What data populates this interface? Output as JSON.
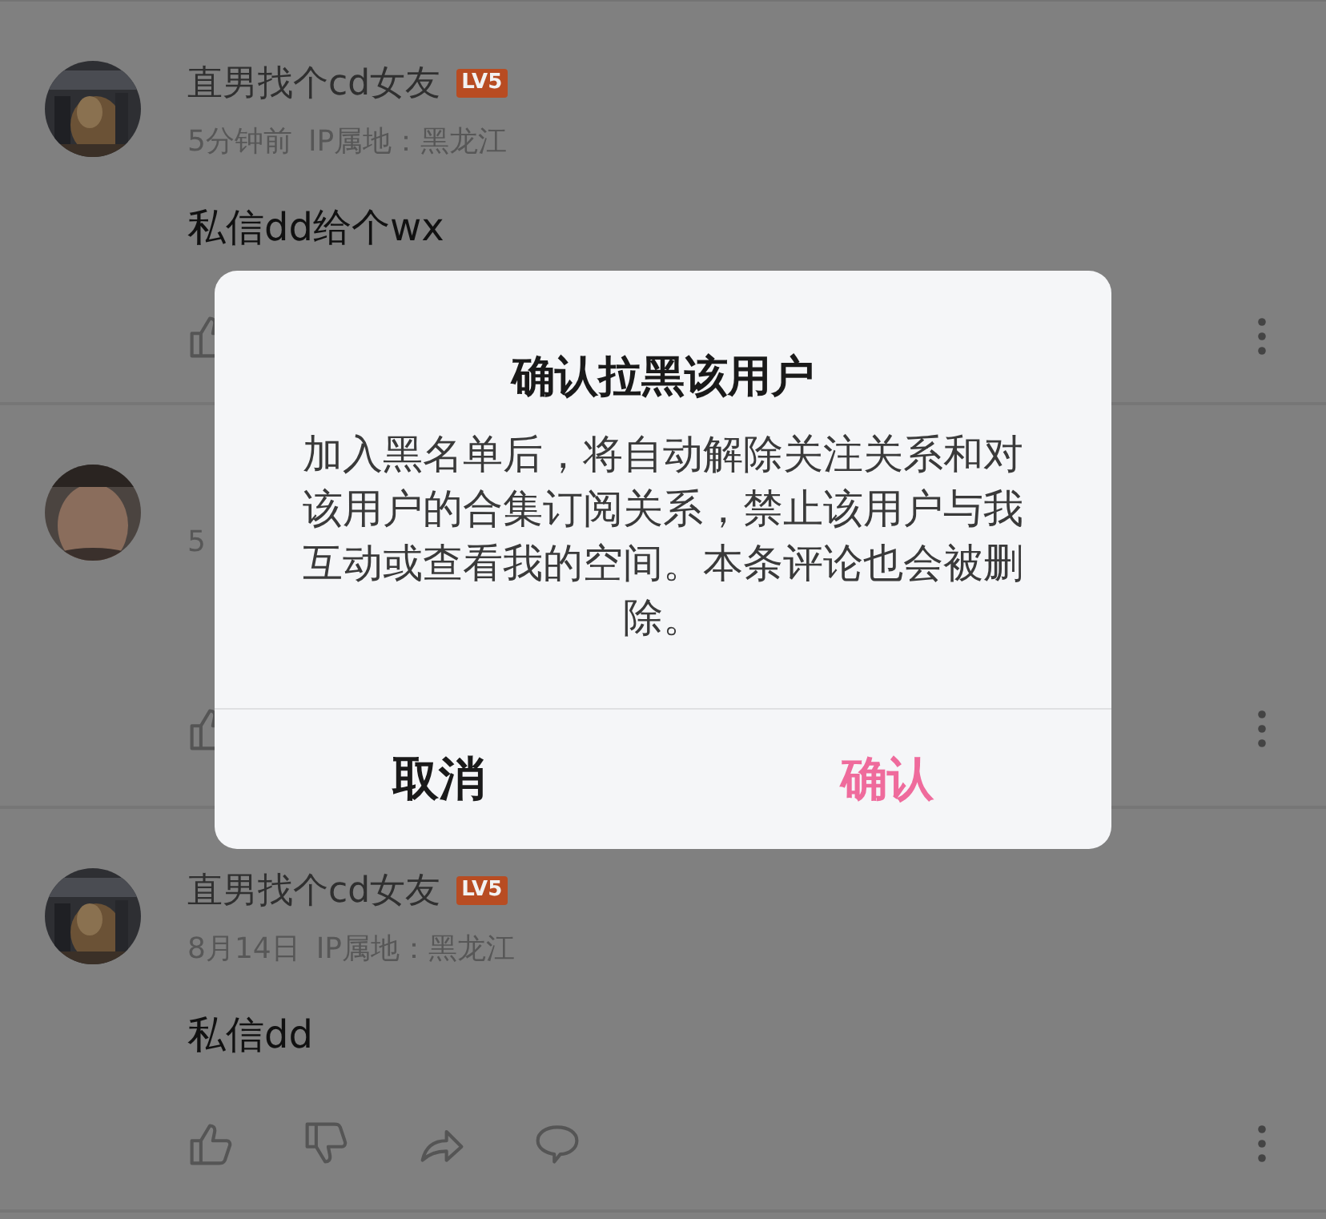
{
  "comments": [
    {
      "name": "直男找个cd女友",
      "badge": "LV5",
      "meta": [
        "5分钟前",
        "IP属地：黑龙江"
      ],
      "content": "私信dd给个wx",
      "actions": [
        {
          "kind": "like"
        }
      ]
    },
    {
      "meta": [
        "5"
      ],
      "actions": [
        {
          "kind": "like"
        }
      ]
    },
    {
      "name": "直男找个cd女友",
      "badge": "LV5",
      "meta": [
        "8月14日",
        "IP属地：黑龙江"
      ],
      "content": "私信dd",
      "actions": [
        {
          "kind": "like"
        },
        {
          "kind": "dislike"
        },
        {
          "kind": "share"
        },
        {
          "kind": "reply"
        }
      ]
    }
  ],
  "dialog": {
    "title": "确认拉黑该用户",
    "message": "加入黑名单后，将自动解除关注关系和对该用户的合集订阅关系，禁止该用户与我互动或查看我的空间。本条评论也会被删除。",
    "buttons": [
      {
        "label": "取消",
        "kind": "cancel"
      },
      {
        "label": "确认",
        "kind": "confirm"
      }
    ]
  }
}
